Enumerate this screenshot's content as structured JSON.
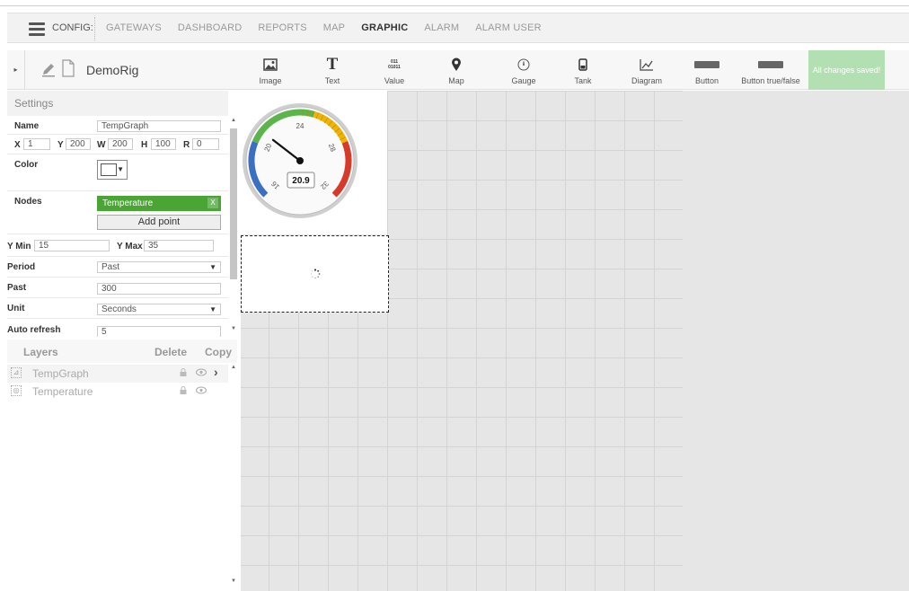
{
  "nav": {
    "config_label": "CONFIG:",
    "items": [
      {
        "label": "GATEWAYS",
        "active": false
      },
      {
        "label": "DASHBOARD",
        "active": false
      },
      {
        "label": "REPORTS",
        "active": false
      },
      {
        "label": "MAP",
        "active": false
      },
      {
        "label": "GRAPHIC",
        "active": true
      },
      {
        "label": "ALARM",
        "active": false
      },
      {
        "label": "ALARM USER",
        "active": false
      }
    ]
  },
  "toolbar": {
    "title": "DemoRig",
    "tools": [
      {
        "label": "Image",
        "icon": "image-icon"
      },
      {
        "label": "Text",
        "icon": "text-icon",
        "glyph": "T"
      },
      {
        "label": "Value",
        "icon": "value-icon",
        "glyph_line1": "011",
        "glyph_line2": "01011"
      },
      {
        "label": "Map",
        "icon": "map-pin-icon"
      },
      {
        "label": "Gauge",
        "icon": "gauge-icon"
      },
      {
        "label": "Tank",
        "icon": "tank-icon"
      },
      {
        "label": "Diagram",
        "icon": "diagram-icon"
      },
      {
        "label": "Button",
        "icon": "button-icon"
      },
      {
        "label": "Button true/false",
        "icon": "button-true-false-icon"
      }
    ],
    "status": "All changes saved!"
  },
  "settings": {
    "header": "Settings",
    "name_label": "Name",
    "name_value": "TempGraph",
    "x_label": "X",
    "x_value": "1",
    "y_label": "Y",
    "y_value": "200",
    "w_label": "W",
    "w_value": "200",
    "h_label": "H",
    "h_value": "100",
    "r_label": "R",
    "r_value": "0",
    "color_label": "Color",
    "color_value": "#ffffff",
    "nodes_label": "Nodes",
    "node_name": "Temperature",
    "node_remove": "X",
    "add_point": "Add point",
    "ymin_label": "Y Min",
    "ymin_value": "15",
    "ymax_label": "Y Max",
    "ymax_value": "35",
    "period_label": "Period",
    "period_value": "Past",
    "past_label": "Past",
    "past_value": "300",
    "unit_label": "Unit",
    "unit_value": "Seconds",
    "refresh_label": "Auto refresh",
    "refresh_value": "5"
  },
  "layers": {
    "title": "Layers",
    "delete": "Delete",
    "copy": "Copy",
    "items": [
      {
        "name": "TempGraph",
        "icon": "chart-icon"
      },
      {
        "name": "Temperature",
        "icon": "gauge-icon"
      }
    ]
  },
  "gauge": {
    "value": "20.9",
    "needle_value": 20.9,
    "min": 16,
    "max": 32,
    "ticks": [
      "16",
      "20",
      "24",
      "28",
      "32"
    ],
    "colors": {
      "cold": "#3a6fc4",
      "good": "#5bb54a",
      "warn": "#f0b400",
      "hot": "#d83a2a"
    }
  }
}
